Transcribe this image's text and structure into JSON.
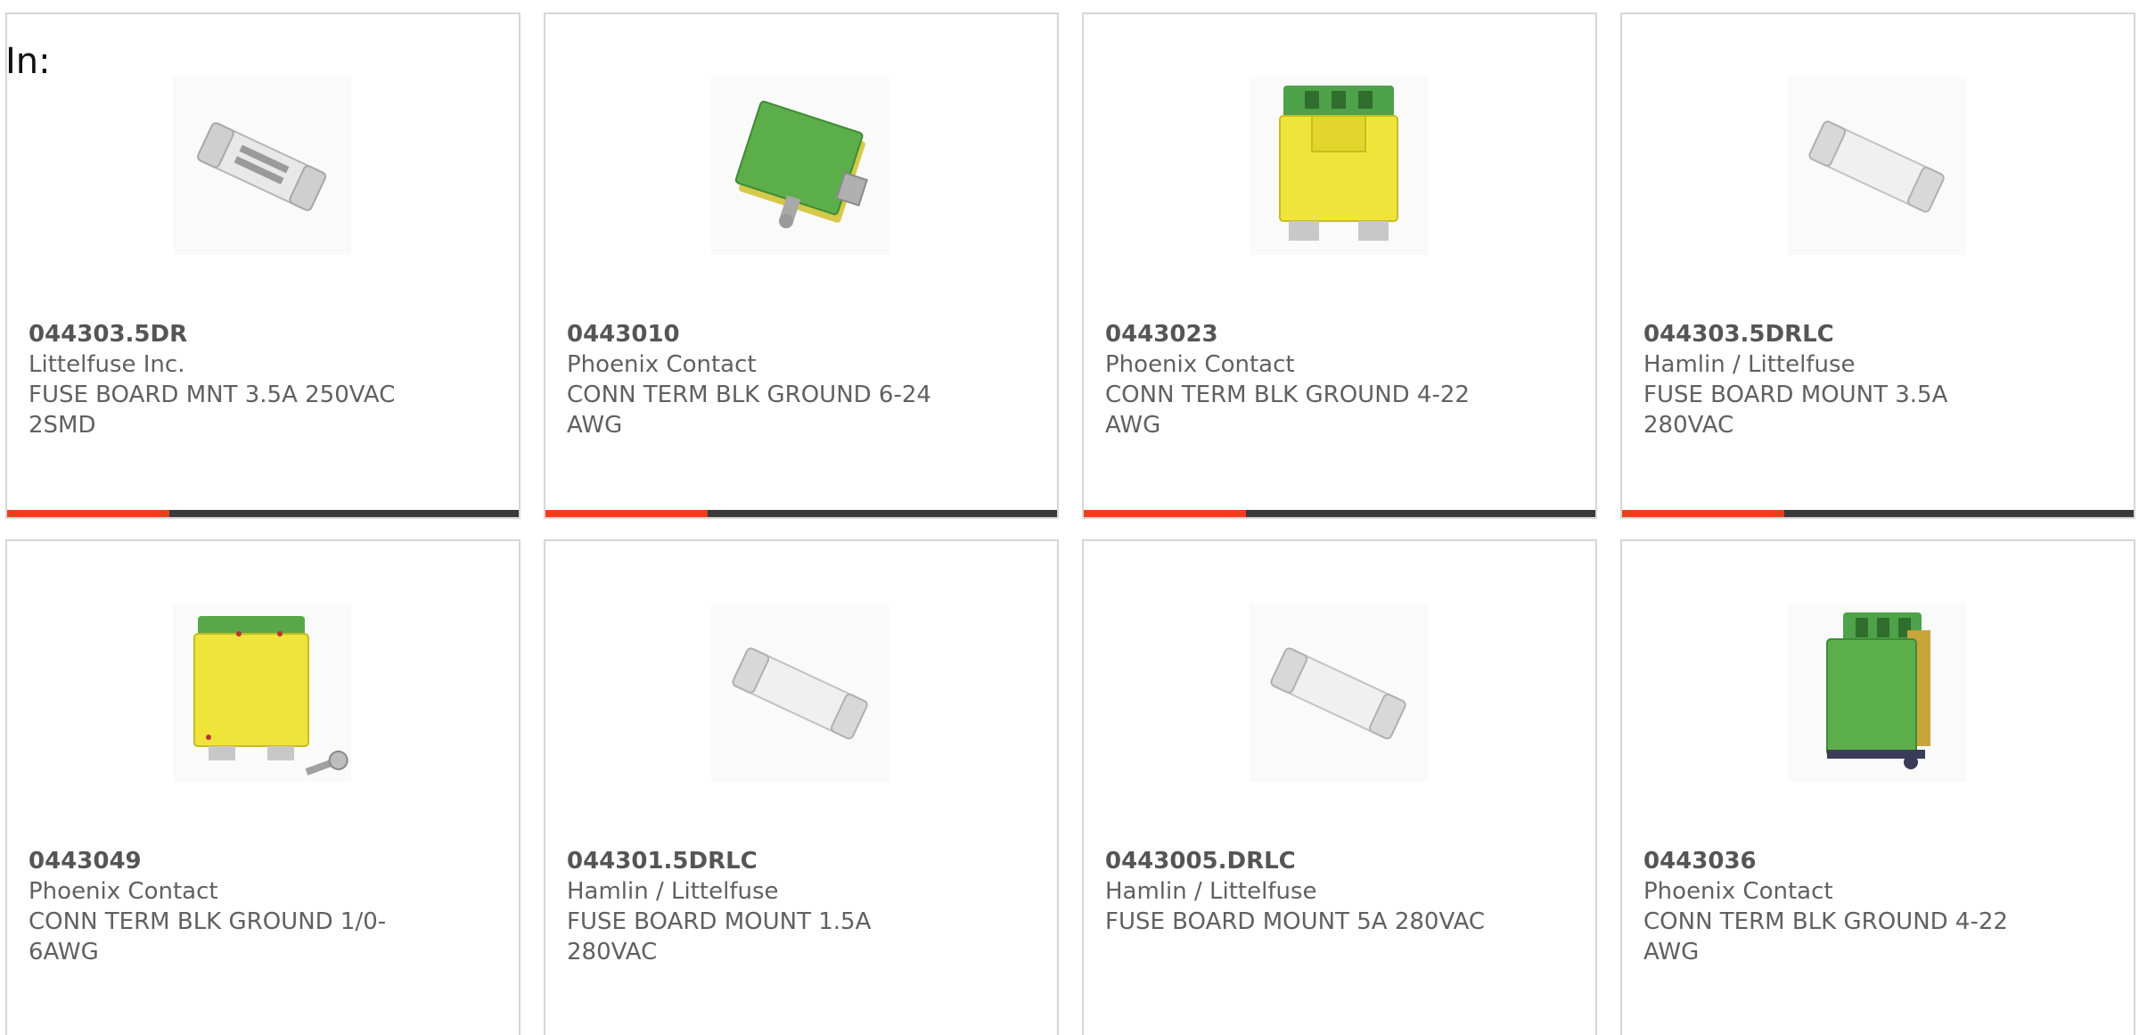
{
  "header": {
    "in_label": "In:"
  },
  "colors": {
    "accent": "#e8421a",
    "bar": "#3a3a3a",
    "border": "#d6d6d6"
  },
  "products": [
    {
      "part_number": "044303.5DR",
      "manufacturer": "Littelfuse Inc.",
      "description": "FUSE BOARD MNT 3.5A 250VAC 2SMD",
      "image": "fuse-icon"
    },
    {
      "part_number": "0443010",
      "manufacturer": "Phoenix Contact",
      "description": "CONN TERM BLK GROUND 6-24 AWG",
      "image": "terminal-block-icon"
    },
    {
      "part_number": "0443023",
      "manufacturer": "Phoenix Contact",
      "description": "CONN TERM BLK GROUND 4-22 AWG",
      "image": "terminal-block-icon"
    },
    {
      "part_number": "044303.5DRLC",
      "manufacturer": "Hamlin / Littelfuse",
      "description": "FUSE BOARD MOUNT 3.5A 280VAC",
      "image": "fuse-icon"
    },
    {
      "part_number": "0443049",
      "manufacturer": "Phoenix Contact",
      "description": "CONN TERM BLK GROUND 1/0-6AWG",
      "image": "terminal-block-icon"
    },
    {
      "part_number": "044301.5DRLC",
      "manufacturer": "Hamlin / Littelfuse",
      "description": "FUSE BOARD MOUNT 1.5A 280VAC",
      "image": "fuse-icon"
    },
    {
      "part_number": "0443005.DRLC",
      "manufacturer": "Hamlin / Littelfuse",
      "description": "FUSE BOARD MOUNT 5A 280VAC",
      "image": "fuse-icon"
    },
    {
      "part_number": "0443036",
      "manufacturer": "Phoenix Contact",
      "description": "CONN TERM BLK GROUND 4-22 AWG",
      "image": "terminal-block-icon"
    }
  ]
}
